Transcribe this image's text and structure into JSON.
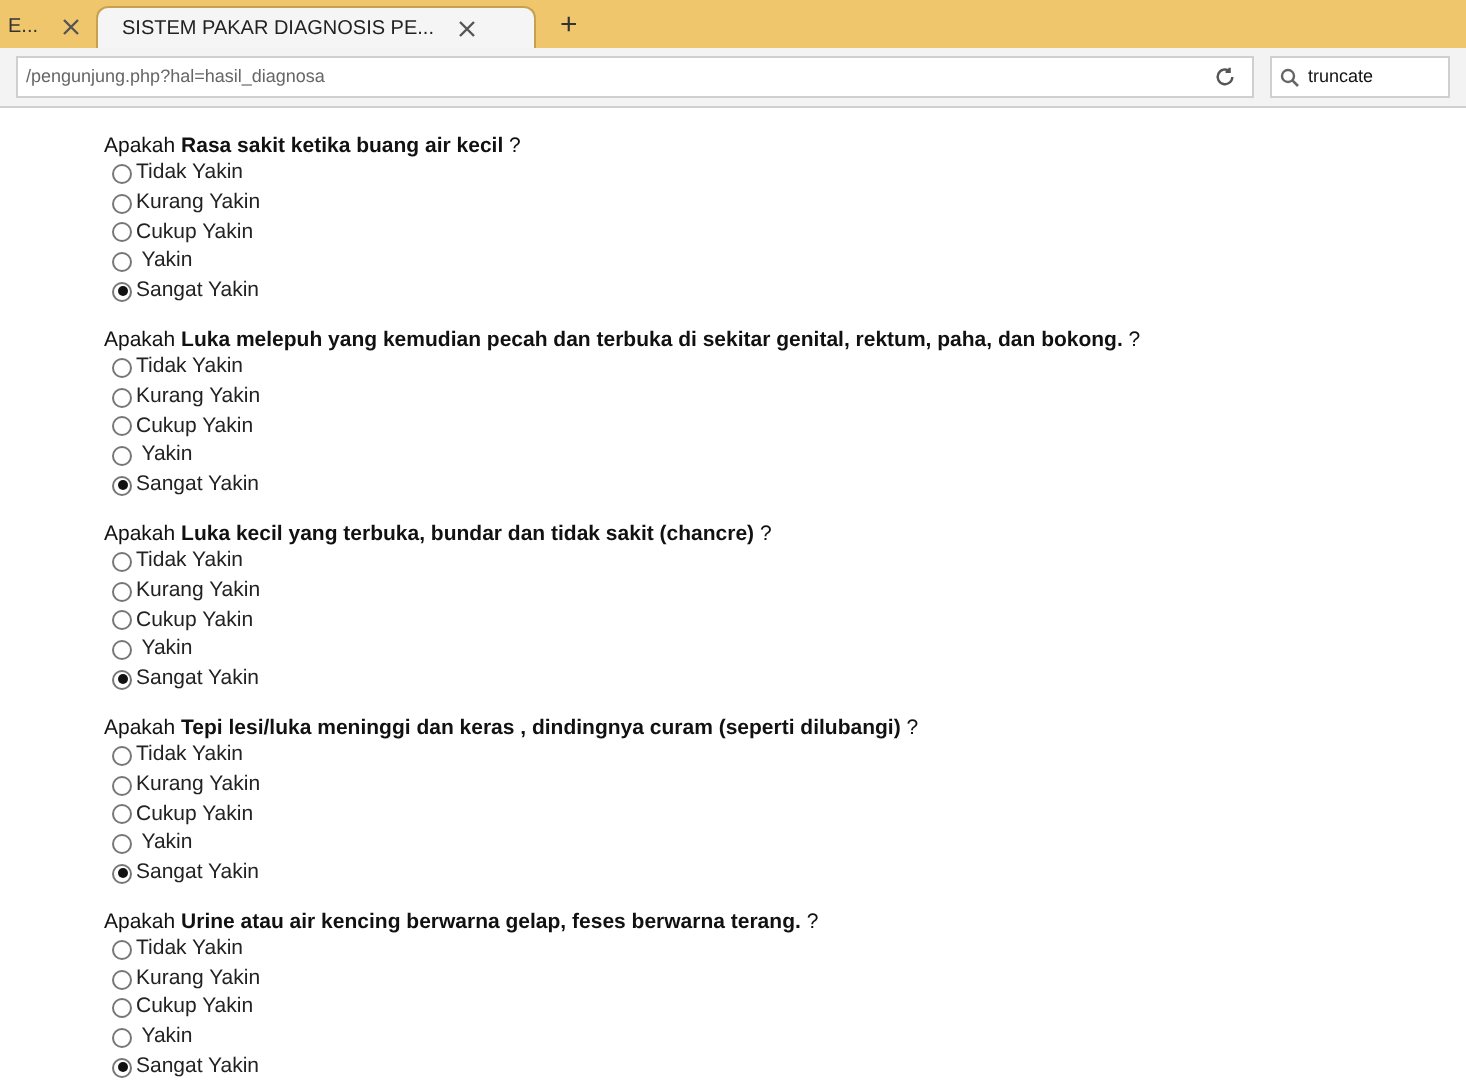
{
  "browser": {
    "tabs": [
      {
        "title": "E...",
        "selected": false
      },
      {
        "title": "SISTEM PAKAR DIAGNOSIS PE...",
        "selected": true
      }
    ],
    "new_tab": "+",
    "address": "/pengunjung.php?hal=hasil_diagnosa",
    "search": {
      "value": "truncate"
    }
  },
  "questions": [
    {
      "text": "Apakah **Rasa sakit ketika buang air kecil** ?",
      "options": [
        {
          "label": "Tidak Yakin",
          "selected": false
        },
        {
          "label": "Kurang Yakin",
          "selected": false
        },
        {
          "label": "Cukup Yakin",
          "selected": false
        },
        {
          "label": " Yakin",
          "selected": false
        },
        {
          "label": "Sangat Yakin",
          "selected": true
        }
      ]
    },
    {
      "text": "Apakah **Luka melepuh yang kemudian pecah dan terbuka di sekitar genital, rektum, paha, dan bokong.** ?",
      "options": [
        {
          "label": "Tidak Yakin",
          "selected": false
        },
        {
          "label": "Kurang Yakin",
          "selected": false
        },
        {
          "label": "Cukup Yakin",
          "selected": false
        },
        {
          "label": " Yakin",
          "selected": false
        },
        {
          "label": "Sangat Yakin",
          "selected": true
        }
      ]
    },
    {
      "text": "Apakah **Luka kecil yang terbuka, bundar dan tidak sakit  (chancre)** ?",
      "options": [
        {
          "label": "Tidak Yakin",
          "selected": false
        },
        {
          "label": "Kurang Yakin",
          "selected": false
        },
        {
          "label": "Cukup Yakin",
          "selected": false
        },
        {
          "label": " Yakin",
          "selected": false
        },
        {
          "label": "Sangat Yakin",
          "selected": true
        }
      ]
    },
    {
      "text": "Apakah **Tepi lesi/luka meninggi dan keras , dindingnya curam (seperti dilubangi)** ?",
      "options": [
        {
          "label": "Tidak Yakin",
          "selected": false
        },
        {
          "label": "Kurang Yakin",
          "selected": false
        },
        {
          "label": "Cukup Yakin",
          "selected": false
        },
        {
          "label": " Yakin",
          "selected": false
        },
        {
          "label": "Sangat Yakin",
          "selected": true
        }
      ]
    },
    {
      "text": "Apakah **Urine atau air kencing berwarna gelap, feses berwarna terang.** ?",
      "options": [
        {
          "label": "Tidak Yakin",
          "selected": false
        },
        {
          "label": "Kurang Yakin",
          "selected": false
        },
        {
          "label": "Cukup Yakin",
          "selected": false
        },
        {
          "label": " Yakin",
          "selected": false
        },
        {
          "label": "Sangat Yakin",
          "selected": true
        }
      ]
    }
  ]
}
